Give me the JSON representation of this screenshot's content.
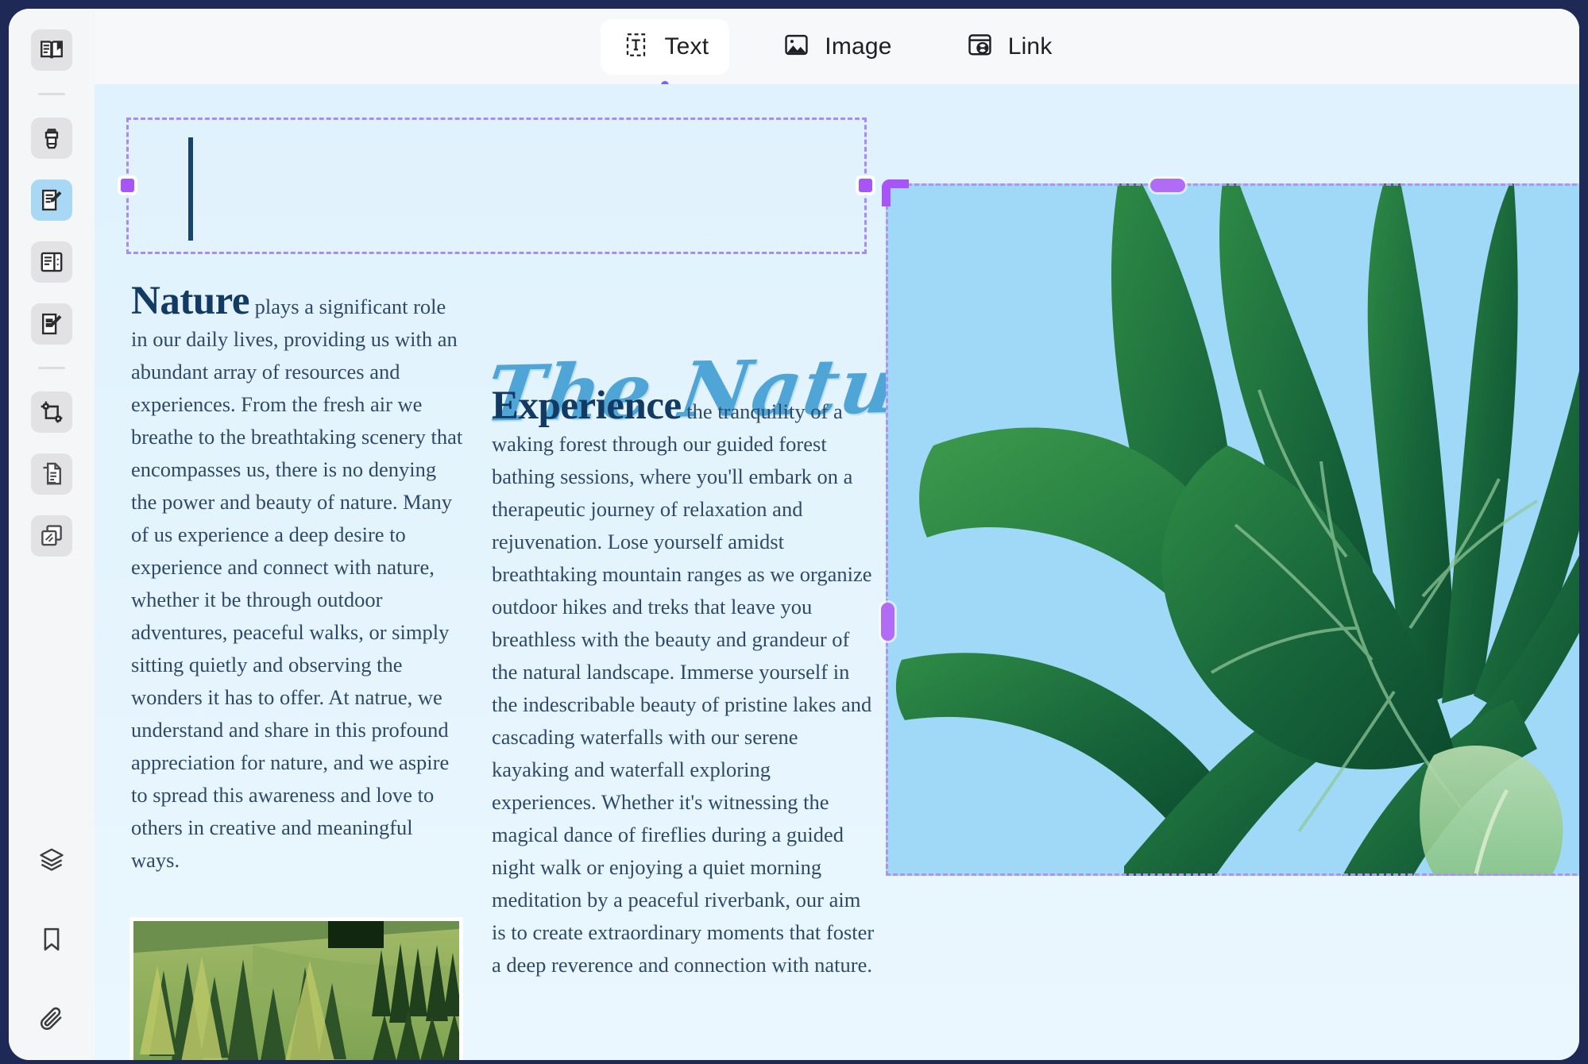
{
  "window": {
    "frame_color": "#1e2a55",
    "canvas_bg": "#dff2fd",
    "accent_purple": "#a855f7",
    "heading_navy": "#123a63",
    "body_navy": "#2e4a68",
    "script_blue": "#4fa5d6"
  },
  "toolbar": {
    "tabs": [
      {
        "label": "Text",
        "icon": "text-box-icon",
        "selected": true
      },
      {
        "label": "Image",
        "icon": "image-icon",
        "selected": false
      },
      {
        "label": "Link",
        "icon": "link-card-icon",
        "selected": false
      }
    ]
  },
  "sidebar": {
    "items": [
      {
        "icon": "open-book-icon",
        "name": "read-mode"
      },
      {
        "icon": "highlighter-icon",
        "name": "highlighter"
      },
      {
        "icon": "note-edit-icon",
        "name": "annotate",
        "active": true
      },
      {
        "icon": "split-page-icon",
        "name": "page-layout"
      },
      {
        "icon": "document-pen-icon",
        "name": "sign-document"
      },
      {
        "icon": "crop-icon",
        "name": "crop"
      },
      {
        "icon": "document-copy-icon",
        "name": "extract-page"
      },
      {
        "icon": "duplicate-pages-icon",
        "name": "duplicate-page"
      }
    ],
    "bottom_items": [
      {
        "icon": "layers-icon",
        "name": "layers"
      },
      {
        "icon": "bookmark-icon",
        "name": "bookmarks"
      },
      {
        "icon": "paperclip-icon",
        "name": "attachments"
      }
    ]
  },
  "document": {
    "title": "The Nature Fix",
    "left_column": {
      "lead_word": "Nature",
      "text": " plays a significant role in our daily lives, providing us with an abundant array of resources and experiences. From the fresh air we breathe to the breathtaking scenery that encompasses us, there is no denying the power and beauty of nature. Many of us experience a deep desire to experience and connect with nature, whether it be through outdoor adventures, peaceful walks, or simply sitting quietly and observing the wonders it has to offer. At natrue, we understand and share in this profound appreciation for nature, and we aspire to spread this awareness and love to others in creative and meaningful ways."
    },
    "right_column": {
      "lead_word": "Experience",
      "text": " the tranquility of a waking forest through our guided forest bathing sessions, where you'll embark on a therapeutic journey of relaxation and rejuvenation. Lose yourself amidst breathtaking mountain ranges as we organize outdoor hikes and treks that leave you breathless with the beauty and grandeur of the natural landscape. Immerse yourself in the indescribable beauty of pristine lakes and cascading waterfalls with our serene kayaking and waterfall exploring experiences. Whether it's witnessing the magical dance of fireflies during a guided night walk or enjoying a quiet morning meditation by a peaceful riverbank, our aim is to create extraordinary moments that foster a deep reverence and connection with nature."
    },
    "images": [
      {
        "name": "monstera-leaf-image",
        "alt": "monstera leaf on blue background",
        "selected": true
      },
      {
        "name": "forest-photo-image",
        "alt": "evergreen forest hillside",
        "selected": false
      }
    ],
    "text_box": {
      "name": "empty-text-box",
      "value": "",
      "selected": true
    }
  }
}
